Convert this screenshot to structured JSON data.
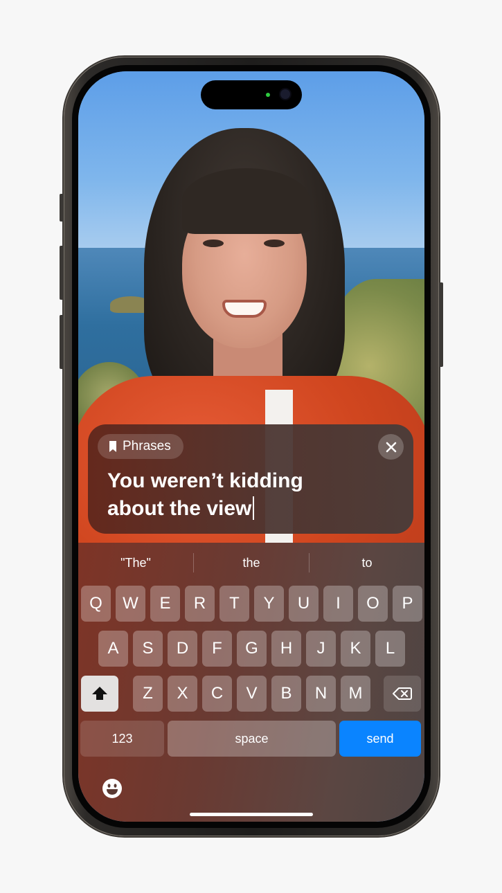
{
  "phrase_panel": {
    "chip_label": "Phrases",
    "chip_icon": "bookmark-icon",
    "close_icon": "close-icon",
    "text_line1": "You weren’t kidding",
    "text_line2": "about the view"
  },
  "keyboard": {
    "suggestions": [
      "\"The\"",
      "the",
      "to"
    ],
    "row1": [
      "Q",
      "W",
      "E",
      "R",
      "T",
      "Y",
      "U",
      "I",
      "O",
      "P"
    ],
    "row2": [
      "A",
      "S",
      "D",
      "F",
      "G",
      "H",
      "J",
      "K",
      "L"
    ],
    "row3": [
      "Z",
      "X",
      "C",
      "V",
      "B",
      "N",
      "M"
    ],
    "numbers_label": "123",
    "space_label": "space",
    "send_label": "send",
    "shift_icon": "shift-icon",
    "delete_icon": "backspace-icon",
    "emoji_icon": "emoji-icon",
    "send_color": "#0a84ff"
  }
}
